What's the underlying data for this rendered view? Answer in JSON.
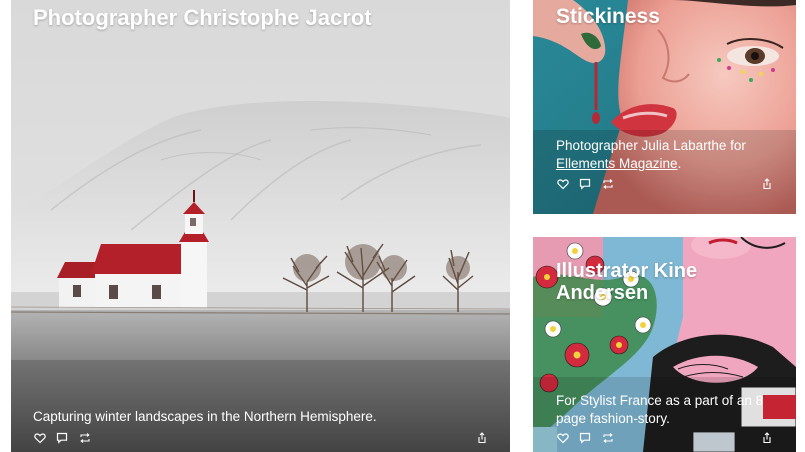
{
  "cards": [
    {
      "title": "Photographer Christophe Jacrot",
      "description": "Capturing winter landscapes in the Northern Hemisphere."
    },
    {
      "title": "Stickiness",
      "description_prefix": "Photographer Julia Labarthe for",
      "description_link": "Ellements Magazine",
      "description_suffix": "."
    },
    {
      "title_line1": "Illustrator Kine",
      "title_line2": "Andersen",
      "description": "For Stylist France as a part of an 8 page fashion-story."
    }
  ],
  "actions": {
    "icons": [
      "heart-icon",
      "comment-icon",
      "repost-icon",
      "share-icon"
    ]
  },
  "colors": {
    "text": "#ffffff",
    "church_roof": "#b3202a",
    "background": "#ffffff"
  }
}
